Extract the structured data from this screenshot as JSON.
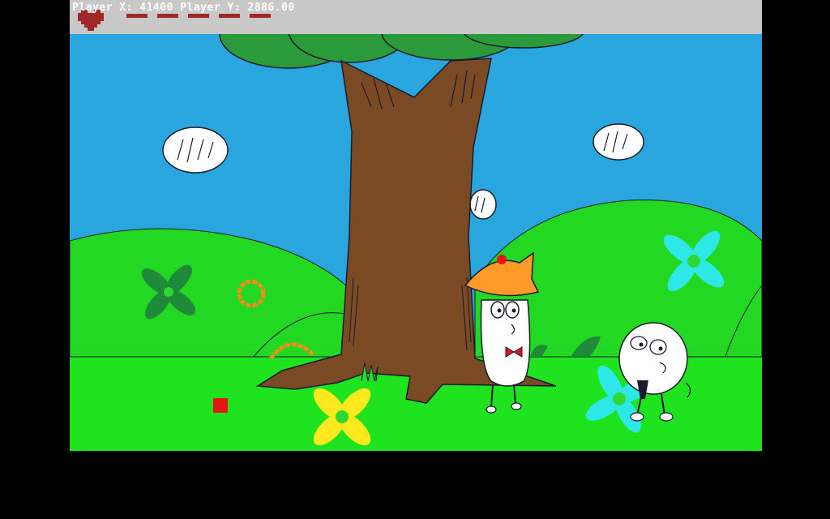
{
  "hud": {
    "coords_text": "Player X: 41400 Player Y: 2886.00",
    "health_segments": 5,
    "colors": {
      "bar": "#c8c8c8",
      "heart": "#a02828",
      "text": "#ffffff"
    }
  },
  "scene": {
    "colors": {
      "sky": "#2aa6df",
      "grass": "#1ee31e",
      "hill": "#22d822",
      "trunk": "#7a4a25",
      "canopy": "#2a9a3a",
      "cloud": "#ffffff",
      "outline": "#1a1a2a",
      "red_block": "#e81414"
    },
    "characters": [
      {
        "name": "tall-egg-character",
        "hat": "orange-cat-hat",
        "accessory": "red-bowtie"
      },
      {
        "name": "round-egg-character",
        "accessory": "black-tie"
      }
    ],
    "flowers": [
      "dark-green",
      "orange-ring",
      "yellow",
      "cyan-large",
      "cyan-small"
    ]
  }
}
